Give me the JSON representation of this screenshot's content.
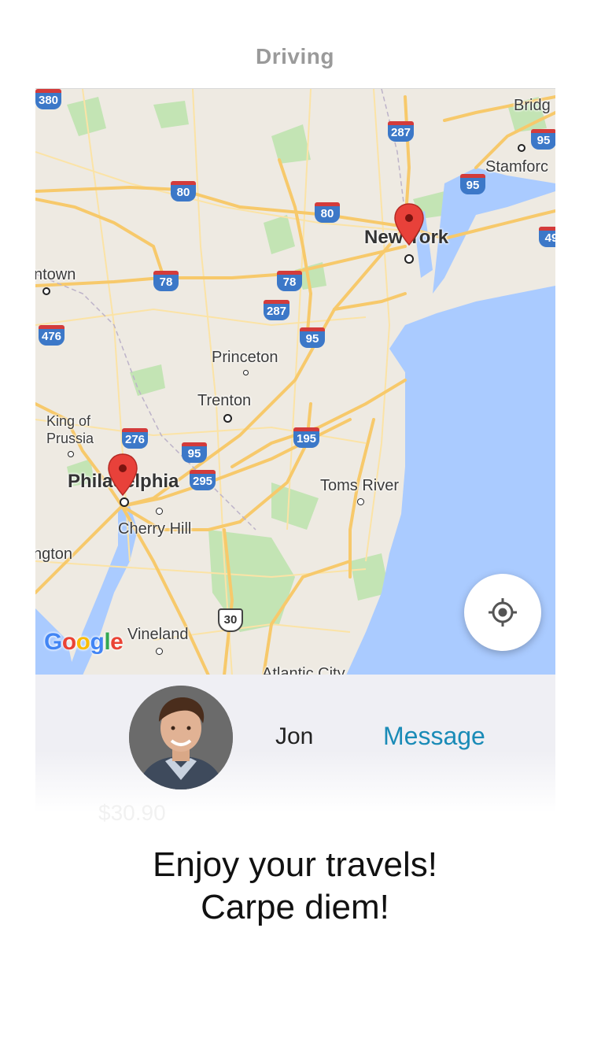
{
  "nav": {
    "title": "Driving"
  },
  "map": {
    "cities": {
      "bridgeport": "Bridg",
      "stamford": "Stamforc",
      "new_york": "New York",
      "allentown": "ntown",
      "princeton": "Princeton",
      "trenton": "Trenton",
      "king_of_prussia_line1": "King of",
      "king_of_prussia_line2": "Prussia",
      "philadelphia": "Philadelphia",
      "toms_river": "Toms River",
      "cherry_hill": "Cherry Hill",
      "wilmington": "ngton",
      "vineland": "Vineland",
      "atlantic_city": "Atlantic City"
    },
    "highways": {
      "i380": "380",
      "i287_top": "287",
      "i95_ne": "95",
      "i95_stamford": "95",
      "i80_west": "80",
      "i80_east": "80",
      "i495": "49",
      "i78_west": "78",
      "i78_east": "78",
      "i287_mid": "287",
      "i476": "476",
      "i95_mid": "95",
      "i276": "276",
      "i95_phl": "95",
      "i295": "295",
      "i195": "195",
      "us30": "30"
    },
    "logo": "Google",
    "colors": {
      "water": "#aacbff",
      "land": "#eeeae2",
      "road": "#f7c96b",
      "park": "#c3e4b4",
      "pin": "#e8413a"
    }
  },
  "driver": {
    "name": "Jon",
    "message_label": "Message",
    "ghost_fare": "$30.90"
  },
  "farewell": {
    "line1": "Enjoy your travels!",
    "line2": "Carpe diem!"
  }
}
